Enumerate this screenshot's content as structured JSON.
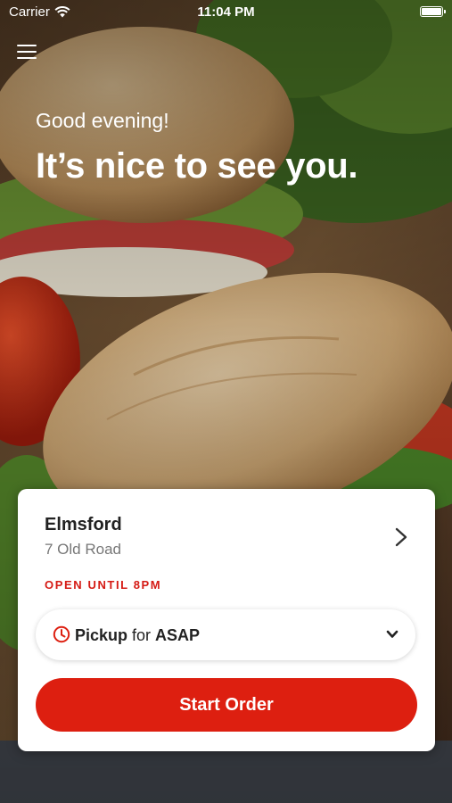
{
  "status_bar": {
    "carrier": "Carrier",
    "time": "11:04 PM"
  },
  "hero": {
    "greeting": "Good evening!",
    "headline": "It’s nice to see you."
  },
  "store_card": {
    "name": "Elmsford",
    "address": "7 Old Road",
    "hours": "OPEN UNTIL 8PM",
    "pickup": {
      "mode": "Pickup",
      "connector": " for ",
      "time": "ASAP"
    },
    "start_button": "Start Order"
  },
  "colors": {
    "accent_red": "#dd1f10",
    "hours_red": "#d51a14"
  },
  "icons": {
    "menu": "hamburger-menu-icon",
    "store_chevron": "chevron-right-icon",
    "clock": "clock-icon",
    "dropdown": "chevron-down-icon",
    "wifi": "wifi-icon",
    "battery": "battery-icon"
  }
}
